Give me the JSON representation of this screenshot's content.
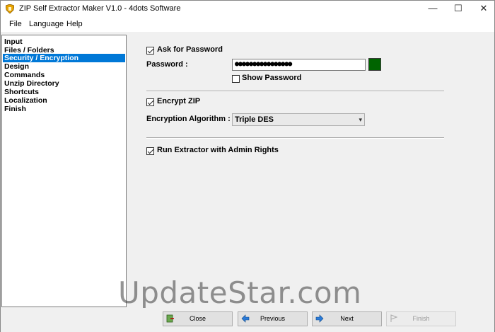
{
  "window": {
    "title": "ZIP Self Extractor Maker V1.0 - 4dots Software"
  },
  "window_controls": {
    "minimize": "—",
    "maximize": "☐",
    "close": "✕"
  },
  "menu": [
    {
      "label": "File"
    },
    {
      "label": "Language"
    },
    {
      "label": "Help"
    }
  ],
  "sidebar": {
    "items": [
      {
        "label": "Input"
      },
      {
        "label": "Files / Folders"
      },
      {
        "label": "Security / Encryption",
        "selected": true
      },
      {
        "label": "Design"
      },
      {
        "label": "Commands"
      },
      {
        "label": "Unzip Directory"
      },
      {
        "label": "Shortcuts"
      },
      {
        "label": "Localization"
      },
      {
        "label": "Finish"
      }
    ]
  },
  "security": {
    "ask_password_label": "Ask for Password",
    "ask_password_checked": true,
    "password_label": "Password :",
    "password_value": "●●●●●●●●●●●●●●●●",
    "password_color": "#006400",
    "show_password_label": "Show Password",
    "show_password_checked": false,
    "encrypt_zip_label": "Encrypt ZIP",
    "encrypt_zip_checked": true,
    "encryption_algorithm_label": "Encryption Algorithm :",
    "encryption_algorithm_value": "Triple DES",
    "admin_rights_label": "Run Extractor with Admin Rights",
    "admin_rights_checked": true
  },
  "buttons": {
    "close": "Close",
    "previous": "Previous",
    "next": "Next",
    "finish": "Finish"
  },
  "watermark": "UpdateStar.com"
}
